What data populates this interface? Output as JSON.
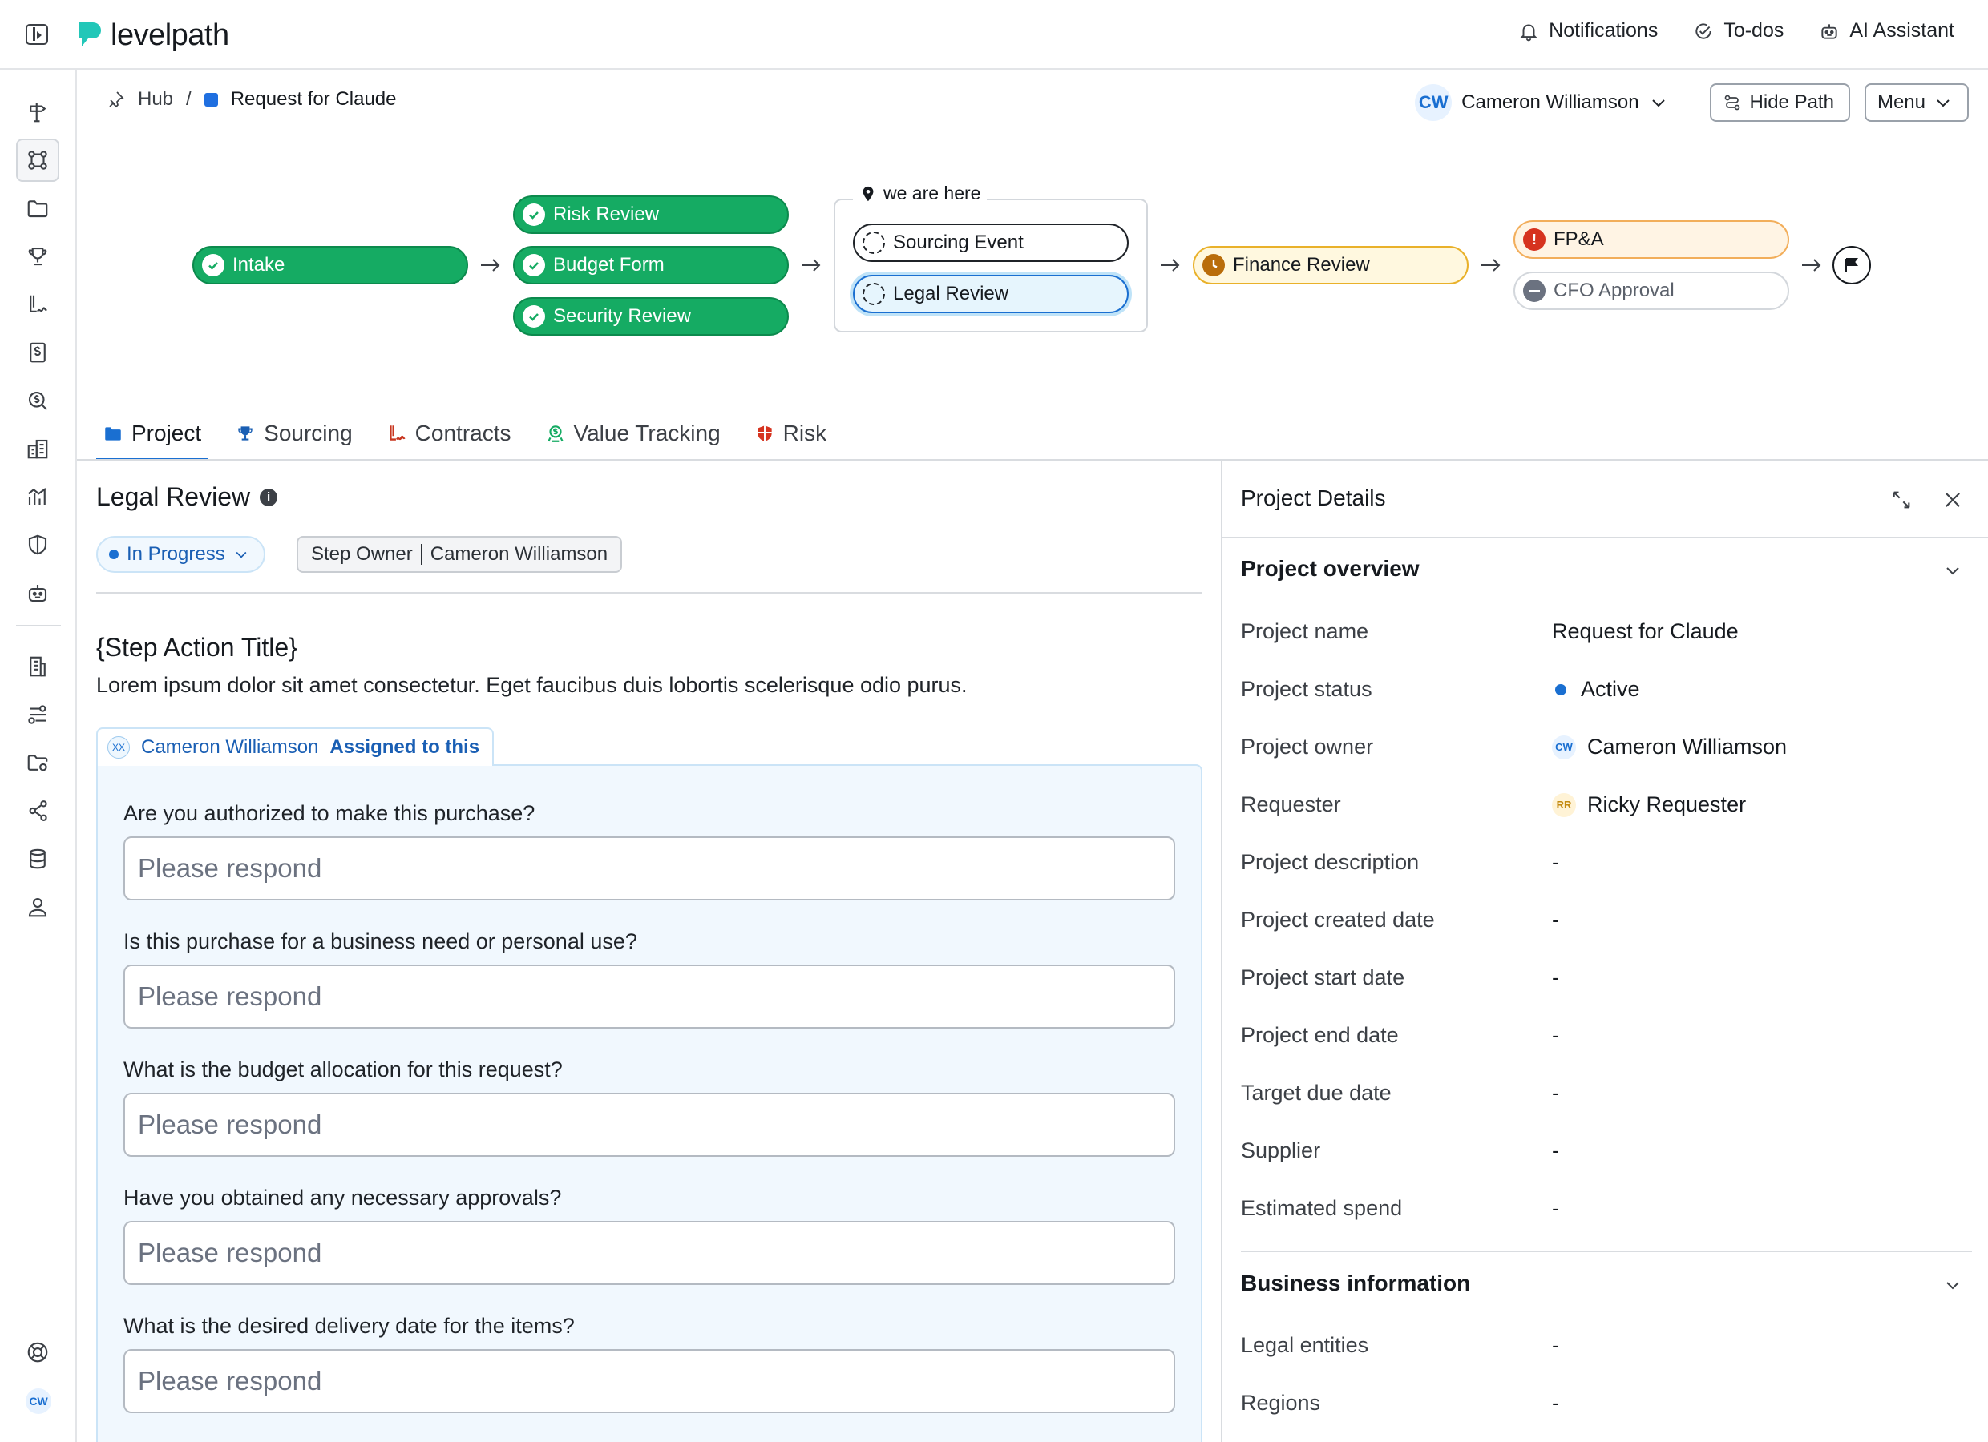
{
  "app": {
    "brand": "levelpath",
    "nav": [
      {
        "label": "Notifications",
        "icon": "bell-icon"
      },
      {
        "label": "To-dos",
        "icon": "check-circle-icon"
      },
      {
        "label": "AI Assistant",
        "icon": "robot-icon"
      }
    ]
  },
  "rail": {
    "items": [
      "signpost-icon",
      "command-icon",
      "folder-icon",
      "trophy-icon",
      "contract-sign-icon",
      "invoice-icon",
      "money-search-icon",
      "buildings-icon",
      "chart-icon",
      "shield-icon",
      "bot-icon",
      "office-building-icon",
      "flows-icon",
      "folder-settings-icon",
      "share-icon",
      "database-icon",
      "user-icon",
      "support-icon"
    ],
    "avatar": "CW"
  },
  "breadcrumb": {
    "hub": "Hub",
    "separator": "/",
    "current": "Request for Claude"
  },
  "header": {
    "user_initials": "CW",
    "user_name": "Cameron Williamson",
    "hide_path": "Hide Path",
    "menu": "Menu"
  },
  "path": {
    "here_label": "we are here",
    "steps": {
      "intake": "Intake",
      "risk_review": "Risk Review",
      "budget_form": "Budget Form",
      "security_review": "Security Review",
      "sourcing_event": "Sourcing Event",
      "legal_review": "Legal Review",
      "finance_review": "Finance Review",
      "fpa": "FP&A",
      "cfo_approval": "CFO Approval"
    },
    "alert_mark": "!"
  },
  "tabs": [
    {
      "label": "Project",
      "active": true
    },
    {
      "label": "Sourcing"
    },
    {
      "label": "Contracts"
    },
    {
      "label": "Value Tracking"
    },
    {
      "label": "Risk"
    }
  ],
  "main": {
    "title": "Legal Review",
    "info_mark": "i",
    "status": "In Progress",
    "owner_label": "Step Owner",
    "owner_name": "Cameron Williamson",
    "action_title": "{Step Action Title}",
    "action_desc": "Lorem ipsum dolor sit amet consectetur. Eget faucibus duis lobortis scelerisque odio purus.",
    "assignee_initials": "XX",
    "assignee_name": "Cameron Williamson",
    "assigned_label": "Assigned to this",
    "questions": [
      {
        "q": "Are you authorized to make this purchase?",
        "placeholder": "Please respond"
      },
      {
        "q": "Is this purchase for a business need or personal use?",
        "placeholder": "Please respond"
      },
      {
        "q": "What is the budget allocation for this request?",
        "placeholder": "Please respond"
      },
      {
        "q": "Have you obtained any necessary approvals?",
        "placeholder": "Please respond"
      },
      {
        "q": "What is the desired delivery date for the items?",
        "placeholder": "Please respond"
      }
    ]
  },
  "details": {
    "title": "Project Details",
    "overview_title": "Project overview",
    "fields": [
      {
        "label": "Project name",
        "value": "Request for Claude"
      },
      {
        "label": "Project status",
        "value": "Active"
      },
      {
        "label": "Project owner",
        "value": "Cameron Williamson",
        "initials": "CW"
      },
      {
        "label": "Requester",
        "value": "Ricky Requester",
        "initials": "RR"
      },
      {
        "label": "Project description",
        "value": "-"
      },
      {
        "label": "Project created date",
        "value": "-"
      },
      {
        "label": "Project start date",
        "value": "-"
      },
      {
        "label": "Project end date",
        "value": "-"
      },
      {
        "label": "Target due date",
        "value": "-"
      },
      {
        "label": "Supplier",
        "value": "-"
      },
      {
        "label": "Estimated spend",
        "value": "-"
      }
    ],
    "business_title": "Business information",
    "business_fields": [
      {
        "label": "Legal entities",
        "value": "-"
      },
      {
        "label": "Regions",
        "value": "-"
      }
    ]
  },
  "colors": {
    "accent": "#1a6fd1",
    "success": "#15ab63",
    "warning": "#e9b12a",
    "danger": "#d6331f"
  }
}
